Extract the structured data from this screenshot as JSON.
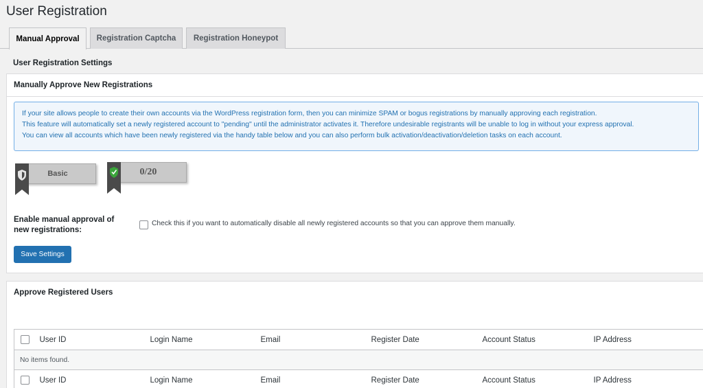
{
  "page": {
    "title": "User Registration"
  },
  "tabs": [
    {
      "label": "Manual Approval",
      "active": true
    },
    {
      "label": "Registration Captcha",
      "active": false
    },
    {
      "label": "Registration Honeypot",
      "active": false
    }
  ],
  "settings": {
    "heading": "User Registration Settings",
    "panel_title": "Manually Approve New Registrations",
    "info_lines": [
      "If your site allows people to create their own accounts via the WordPress registration form, then you can minimize SPAM or bogus registrations by manually approving each registration.",
      "This feature will automatically set a newly registered account to \"pending\" until the administrator activates it. Therefore undesirable registrants will be unable to log in without your express approval.",
      "You can view all accounts which have been newly registered via the handy table below and you can also perform bulk activation/deactivation/deletion tasks on each account."
    ],
    "badge_level": "Basic",
    "badge_score": "0/20",
    "enable_label": "Enable manual approval of new registrations:",
    "enable_description": "Check this if you want to automatically disable all newly registered accounts so that you can approve them manually.",
    "enable_checked": false,
    "save_label": "Save Settings"
  },
  "approve": {
    "panel_title": "Approve Registered Users",
    "columns": [
      "User ID",
      "Login Name",
      "Email",
      "Register Date",
      "Account Status",
      "IP Address"
    ],
    "empty_message": "No items found."
  },
  "colors": {
    "accent": "#2271b1",
    "info_bg": "#f0f6fc",
    "info_border": "#72aee6",
    "shield_green": "#3aa43a"
  }
}
